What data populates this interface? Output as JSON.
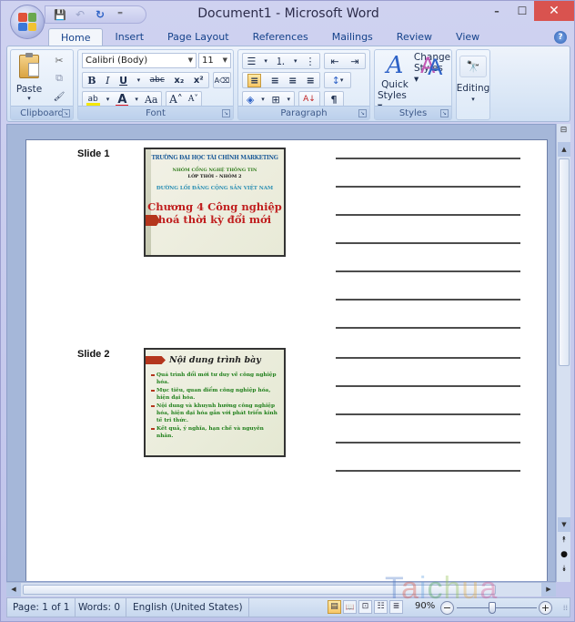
{
  "window": {
    "title": "Document1 - Microsoft Word",
    "controls": {
      "minimize": "–",
      "maximize": "☐",
      "close": "✕"
    }
  },
  "quick_access": {
    "save_icon": "💾",
    "undo_icon": "↶",
    "redo_icon": "↻",
    "customize_icon": "⁼"
  },
  "tabs": [
    {
      "label": "Home",
      "active": true
    },
    {
      "label": "Insert",
      "active": false
    },
    {
      "label": "Page Layout",
      "active": false
    },
    {
      "label": "References",
      "active": false
    },
    {
      "label": "Mailings",
      "active": false
    },
    {
      "label": "Review",
      "active": false
    },
    {
      "label": "View",
      "active": false
    }
  ],
  "help_icon": "?",
  "ribbon": {
    "clipboard": {
      "label": "Clipboard",
      "paste_label": "Paste",
      "paste_arrow": "▾",
      "cut_icon": "✂",
      "copy_icon": "⧉",
      "format_painter_icon": "🖌"
    },
    "font": {
      "label": "Font",
      "font_name": "Calibri (Body)",
      "font_size": "11",
      "bold": "B",
      "italic": "I",
      "underline": "U",
      "strikethrough": "abc",
      "subscript": "x₂",
      "superscript": "x²",
      "clear_format": "A⌫",
      "highlight": "ab",
      "font_color": "A",
      "change_case": "Aa",
      "grow": "A˄",
      "shrink": "A˅",
      "highlight_color": "#f3e600",
      "font_color_bar": "#e01b24"
    },
    "paragraph": {
      "label": "Paragraph",
      "bullets": "☰",
      "numbering": "⒈",
      "multilevel": "⋮",
      "decrease_indent": "⇤",
      "increase_indent": "⇥",
      "align_left": "≡",
      "align_center": "≡",
      "align_right": "≡",
      "justify": "≡",
      "line_spacing": "↕",
      "shading": "◈",
      "borders": "⊞",
      "sort": "A↓",
      "show_marks": "¶"
    },
    "styles": {
      "label": "Styles",
      "quick_styles_line1": "Quick",
      "quick_styles_line2": "Styles ▾",
      "change_styles_line1": "Change",
      "change_styles_line2": "Styles ▾"
    },
    "editing": {
      "label": "Editing",
      "arrow": "▾",
      "icon": "🔭"
    },
    "launcher_icon": "↘"
  },
  "document": {
    "slides": [
      {
        "label": "Slide 1",
        "lines": [
          "TRƯỜNG ĐẠI HỌC TÀI CHÍNH MARKETING",
          "NHÓM CỔNG NGHỆ THÔNG TIN",
          "LỚP THỜI – NHÓM 2",
          "ĐƯỜNG LỐI ĐẢNG CỘNG SẢN VIỆT NAM",
          "Chương 4 Công nghiệp hoá thời kỳ đổi mới"
        ]
      },
      {
        "label": "Slide 2",
        "title": "Nội dung trình bày",
        "bullets": [
          "Quá trình đổi mới tư duy về công nghiệp hóa.",
          "Mục tiêu, quan điểm công nghiệp hóa, hiện đại hóa.",
          "Nội dung và khuynh hướng công nghiệp hóa, hiện đại hóa gắn với phát triển kinh tế tri thức.",
          "Kết quả, ý nghĩa, hạn chế và nguyên nhân."
        ]
      }
    ],
    "note_lines_slide1": 7,
    "note_lines_slide2": 5
  },
  "scrollbars": {
    "ruler_icon": "⊟",
    "up_icon": "▲",
    "down_icon": "▼",
    "prev_page_icon": "⯭",
    "browse_object_icon": "●",
    "next_page_icon": "⯯",
    "left_icon": "◀",
    "right_icon": "▶"
  },
  "statusbar": {
    "page": "Page: 1 of 1",
    "words": "Words: 0",
    "language": "English (United States)",
    "views": [
      {
        "name": "print-layout",
        "icon": "▤",
        "active": true
      },
      {
        "name": "full-screen-reading",
        "icon": "📖",
        "active": false
      },
      {
        "name": "web-layout",
        "icon": "⊡",
        "active": false
      },
      {
        "name": "outline",
        "icon": "☷",
        "active": false
      },
      {
        "name": "draft",
        "icon": "≣",
        "active": false
      }
    ],
    "zoom_level": "90%",
    "zoom_percent_value": 90,
    "zoom_minus": "−",
    "zoom_plus": "+",
    "grip": "⁞⁞"
  },
  "watermark": [
    "T",
    "a",
    "i",
    "c",
    "h",
    "u",
    "a"
  ]
}
